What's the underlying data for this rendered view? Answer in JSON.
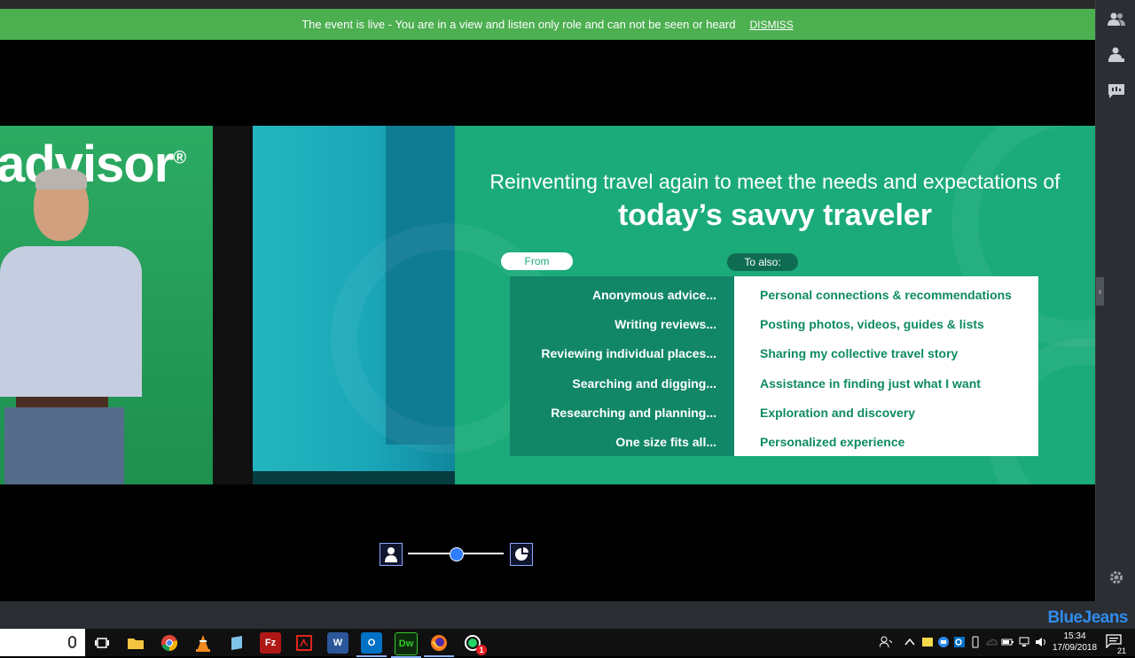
{
  "banner": {
    "message": "The event is live - You are in a view and listen only role and can not be seen or heard",
    "dismiss_label": "DISMISS"
  },
  "stage": {
    "brand_fragment": "advisor",
    "brand_mark": "®"
  },
  "slide": {
    "title_line1": "Reinventing travel again to meet the needs and expectations of",
    "title_line2": "today’s savvy traveler",
    "from_label": "From",
    "to_label": "To also:",
    "rows": [
      {
        "from": "Anonymous advice...",
        "to": "Personal connections & recommendations"
      },
      {
        "from": "Writing reviews...",
        "to": "Posting photos, videos, guides & lists"
      },
      {
        "from": "Reviewing individual places...",
        "to": "Sharing my collective travel story"
      },
      {
        "from": "Searching and digging...",
        "to": "Assistance in finding just what I want"
      },
      {
        "from": "Researching and planning...",
        "to": "Exploration and discovery"
      },
      {
        "from": "One size fits all...",
        "to": "Personalized experience"
      }
    ]
  },
  "layout_control": {
    "slider_value": 0.5
  },
  "brand": {
    "name": "BlueJeans"
  },
  "taskbar": {
    "apps": [
      {
        "name": "task-view"
      },
      {
        "name": "file-explorer"
      },
      {
        "name": "chrome"
      },
      {
        "name": "vlc"
      },
      {
        "name": "notepad"
      },
      {
        "name": "filezilla",
        "label": "Fz"
      },
      {
        "name": "acrobat"
      },
      {
        "name": "word",
        "label": "W"
      },
      {
        "name": "outlook",
        "label": "O"
      },
      {
        "name": "dreamweaver",
        "label": "Dw"
      },
      {
        "name": "firefox"
      },
      {
        "name": "whatsapp",
        "badge": "1"
      }
    ],
    "clock_time": "15:34",
    "clock_date": "17/09/2018",
    "notification_count": "21"
  },
  "colors": {
    "banner": "#4caf50",
    "slide_bg": "#1bab7a",
    "slide_accent": "#0e8a63",
    "bluejeans": "#2f8cf0"
  }
}
